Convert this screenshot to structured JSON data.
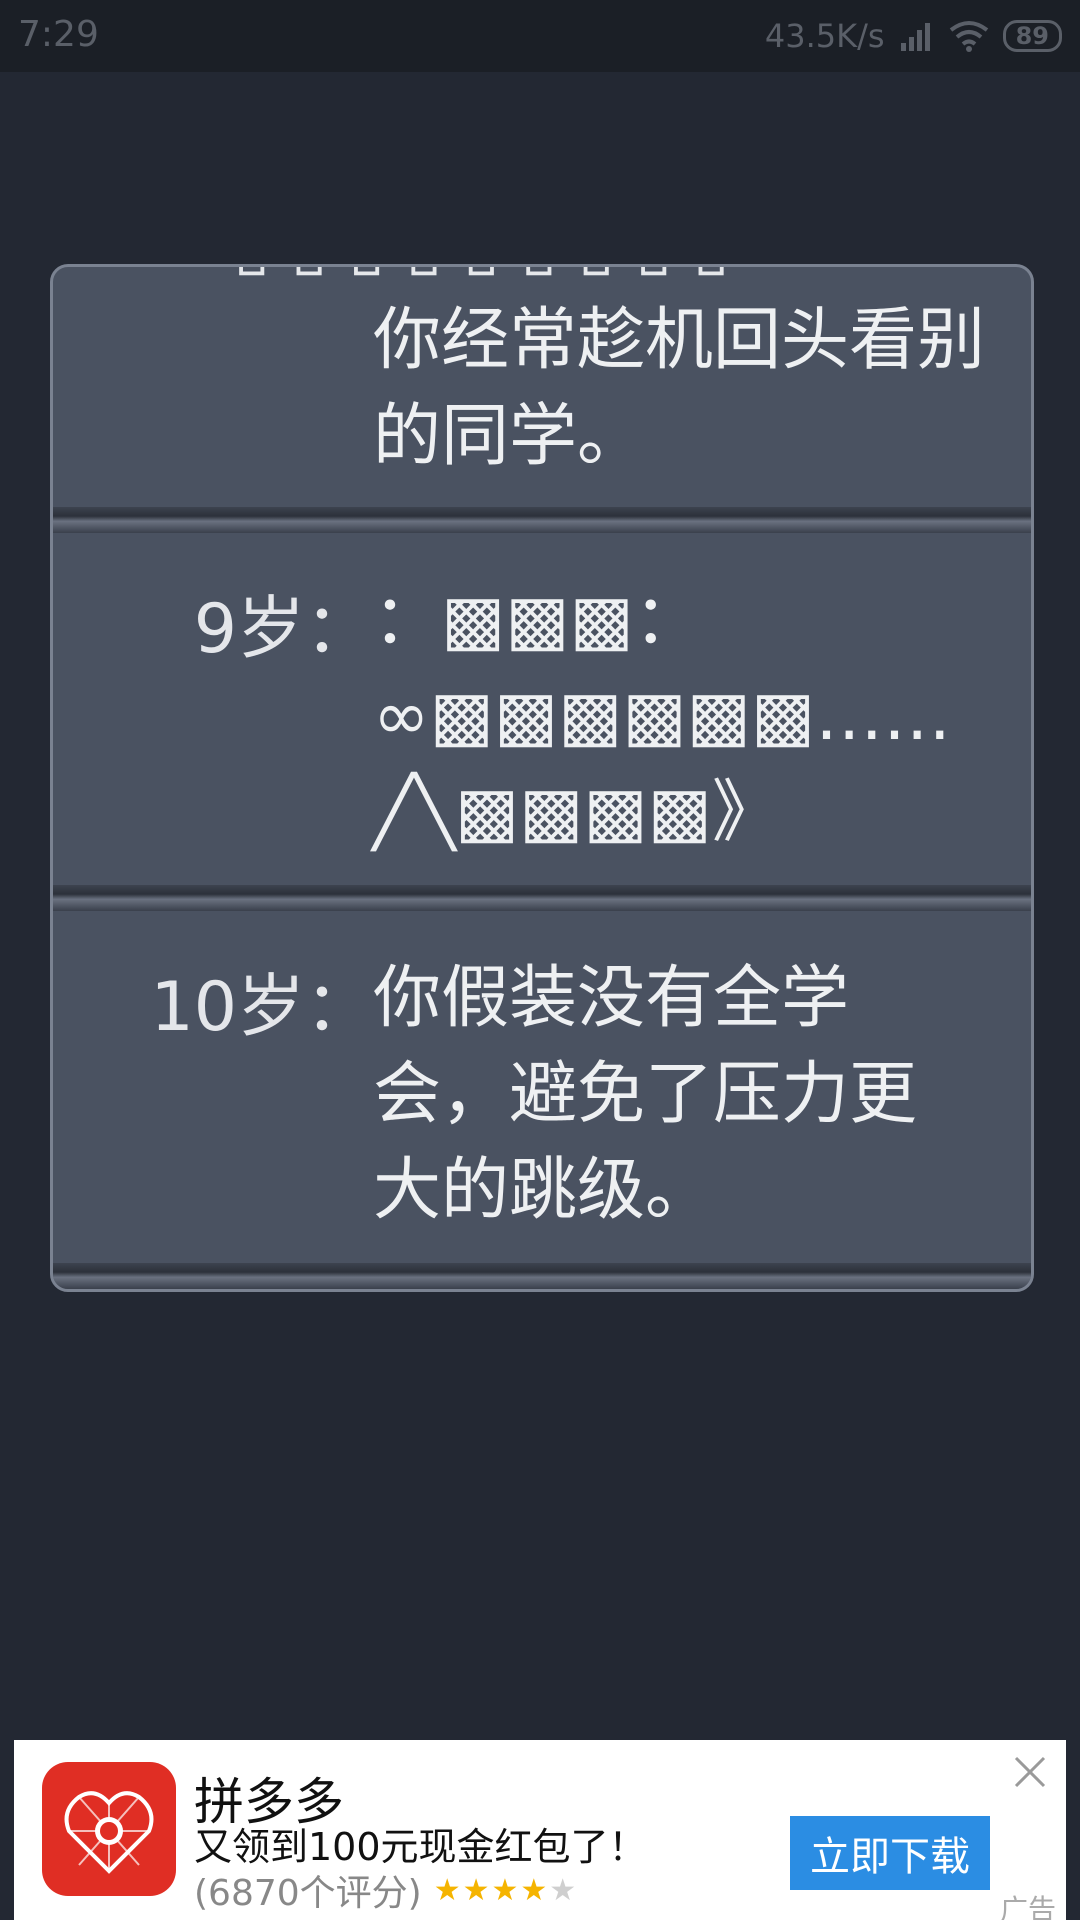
{
  "status_bar": {
    "time": "7:29",
    "net_speed": "43.5K/s",
    "battery": "89"
  },
  "entries": [
    {
      "ghost": "▯▯▯▯▯▯▯▯▯",
      "age": "",
      "text": "你经常趁机回头看别的同学。"
    },
    {
      "age": "9岁：",
      "text": "：▩▩▩：\n∞▩▩▩▩▩▩……\n╱╲▩▩▩▩》"
    },
    {
      "age": "10岁：",
      "text": "你假装没有全学\n会，避免了压力更\n大的跳级。"
    }
  ],
  "ad": {
    "app_name": "拼多多",
    "description": "又领到100元现金红包了！",
    "rating_text": "(6870个评分)",
    "rating_value": 4,
    "button_label": "立即下载",
    "tag": "广告",
    "brand_color": "#e02e24",
    "button_color": "#2b8de3"
  }
}
